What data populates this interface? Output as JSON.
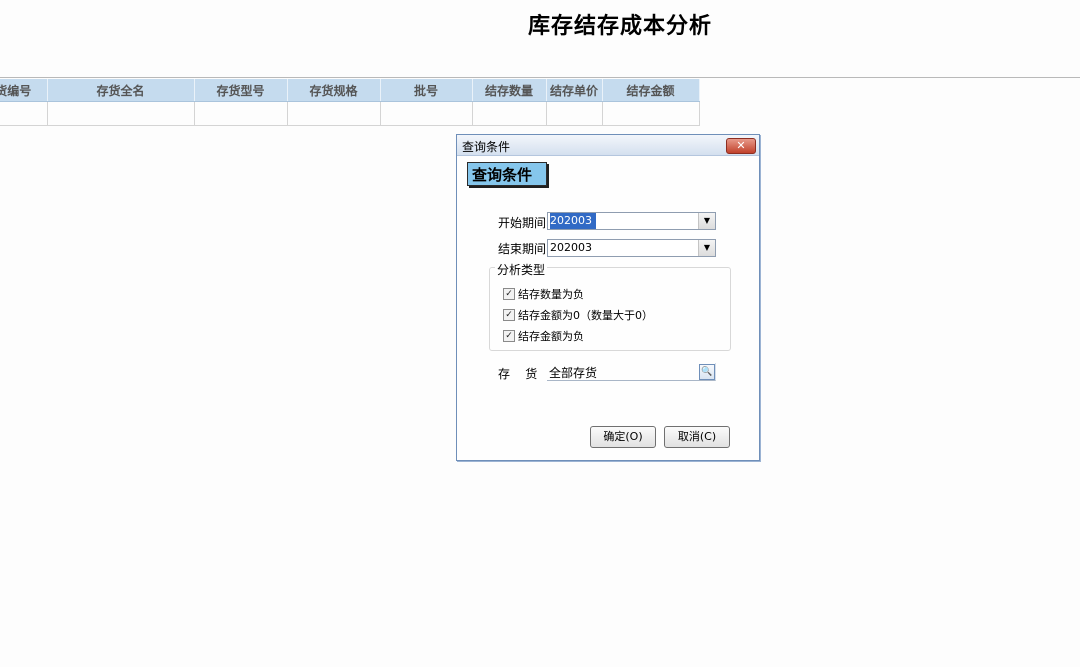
{
  "report": {
    "title": "库存结存成本分析",
    "columns": [
      "货编号",
      "存货全名",
      "存货型号",
      "存货规格",
      "批号",
      "结存数量",
      "结存单价",
      "结存金额"
    ]
  },
  "dialog": {
    "title": "查询条件",
    "close_icon": "close-x-icon",
    "banner": "查询条件",
    "start_period_label": "开始期间",
    "start_period_value": "202003",
    "end_period_label": "结束期间",
    "end_period_value": "202003",
    "analysis_group_label": "分析类型",
    "options": [
      {
        "label": "结存数量为负",
        "checked": true
      },
      {
        "label": "结存金额为0（数量大于0）",
        "checked": true
      },
      {
        "label": "结存金额为负",
        "checked": true
      }
    ],
    "inventory_label": "存    货",
    "inventory_value": "全部存货",
    "ok_label": "确定(O)",
    "cancel_label": "取消(C)"
  },
  "colors": {
    "header_bg": "#c5dbee",
    "banner_bg": "#85c6ec",
    "selection": "#316ac5"
  }
}
